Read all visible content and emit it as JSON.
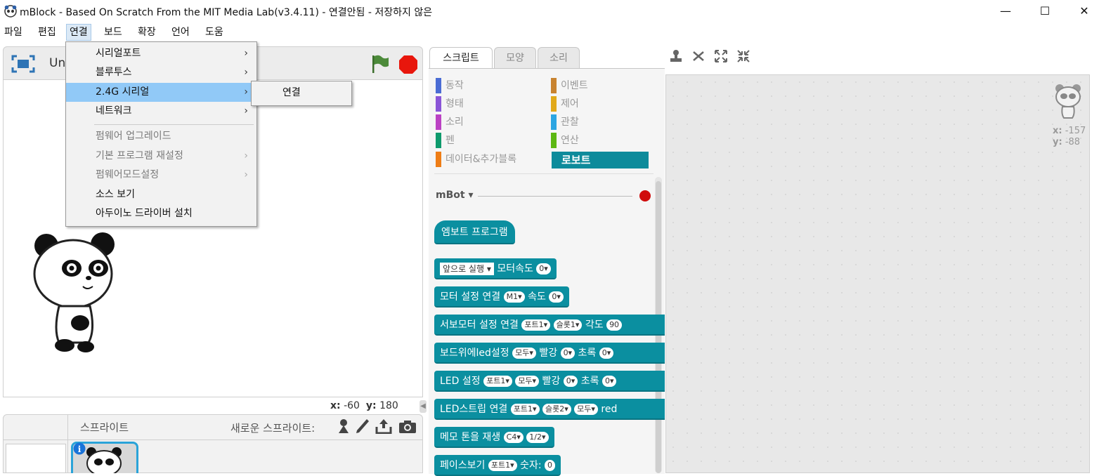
{
  "window": {
    "title": "mBlock - Based On Scratch From the MIT Media Lab(v3.4.11) - 연결안됨 - 저장하지 않은",
    "minimize": "—",
    "maximize": "☐",
    "close": "✕"
  },
  "menubar": [
    "파일",
    "편집",
    "연결",
    "보드",
    "확장",
    "언어",
    "도움"
  ],
  "connect_menu": {
    "items": [
      {
        "label": "시리얼포트",
        "arrow": "›"
      },
      {
        "label": "블루투스",
        "arrow": "›"
      },
      {
        "label": "2.4G 시리얼",
        "arrow": "›"
      },
      {
        "label": "네트워크",
        "arrow": "›"
      },
      {
        "label": "펌웨어 업그레이드",
        "arrow": ""
      },
      {
        "label": "기본 프로그램 재설정",
        "arrow": "›"
      },
      {
        "label": "펌웨어모드설정",
        "arrow": "›"
      },
      {
        "label": "소스 보기",
        "arrow": ""
      },
      {
        "label": "아두이노 드라이버 설치",
        "arrow": ""
      }
    ],
    "submenu_item": "연결"
  },
  "stage": {
    "title_partial": "Un",
    "coords": {
      "x_label": "x:",
      "x": "-60",
      "y_label": "y:",
      "y": "180"
    }
  },
  "sprites": {
    "label": "스프라이트",
    "new_label": "새로운 스프라이트:"
  },
  "tabs": [
    "스크립트",
    "모양",
    "소리"
  ],
  "categories": [
    {
      "label": "동작",
      "color": "#4a6cd4"
    },
    {
      "label": "이벤트",
      "color": "#c88330"
    },
    {
      "label": "형태",
      "color": "#8a55d7"
    },
    {
      "label": "제어",
      "color": "#e1a91a"
    },
    {
      "label": "소리",
      "color": "#bb42c3"
    },
    {
      "label": "관찰",
      "color": "#2ca5e2"
    },
    {
      "label": "펜",
      "color": "#0e9a6c"
    },
    {
      "label": "연산",
      "color": "#5cb712"
    },
    {
      "label": "데이터&추가블록",
      "color": "#ee7d16"
    },
    {
      "label": "로보트",
      "color": "#0e8b9b"
    }
  ],
  "palette": {
    "device": "mBot ▾",
    "hat_block": "엠보트 프로그램",
    "blocks": [
      {
        "prefix_dd": "앞으로 실행 ▾",
        "text": "모터속도",
        "pills": [
          "0▾"
        ]
      },
      {
        "text": "모터 설정 연결",
        "pills": [
          "M1▾"
        ],
        "text2": "속도",
        "pills2": [
          "0▾"
        ]
      },
      {
        "text": "서보모터 설정 연결",
        "pills": [
          "포트1▾",
          "슬롯1▾"
        ],
        "text2": "각도",
        "pills2": [
          "90"
        ]
      },
      {
        "text": "보드위에led설정",
        "pills": [
          "모두▾"
        ],
        "text2": "빨강",
        "pills2": [
          "0▾"
        ],
        "text3": "초록",
        "pills3": [
          "0▾"
        ]
      },
      {
        "text": "LED 설정",
        "pills": [
          "포트1▾",
          "모두▾"
        ],
        "text2": "빨강",
        "pills2": [
          "0▾"
        ],
        "text3": "초록",
        "pills3": [
          "0▾"
        ]
      },
      {
        "text": "LED스트립 연결",
        "pills": [
          "포트1▾",
          "슬롯2▾",
          "모두▾"
        ],
        "text2": "red",
        "pills2": []
      },
      {
        "text": "메모 톤을 재생",
        "pills": [
          "C4▾",
          "1/2▾"
        ]
      },
      {
        "text": "페이스보기",
        "pills": [
          "포트1▾"
        ],
        "text2": "숫자:",
        "pills2": [
          "0"
        ]
      }
    ]
  },
  "script_area": {
    "x_label": "x:",
    "x": "-157",
    "y_label": "y:",
    "y": "-88"
  }
}
